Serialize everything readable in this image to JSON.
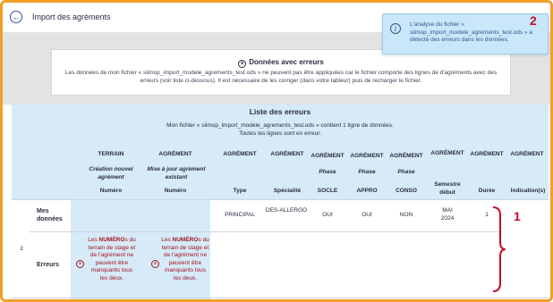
{
  "header": {
    "title": "Import des agréments",
    "back_icon": "back-arrow-icon"
  },
  "toast": {
    "text": "L'analyse du fichier « siimop_import_modele_agrements_test.ods » a détecté des erreurs dans les données.",
    "icon": "info-icon",
    "close": "✕"
  },
  "markers": {
    "m1": "1",
    "m2": "2"
  },
  "error_banner": {
    "title": "Données avec erreurs",
    "icon": "error-circle-icon",
    "text": "Les données de mon fichier « siimop_import_modele_agrements_test.ods » ne peuvent pas être appliquées car le fichier comporte des lignes de d'agréments avec des erreurs (voir liste ci-dessous). Il est nécessaire de les corriger (dans votre tableur) puis de recharger le fichier."
  },
  "error_list": {
    "title": "Liste des erreurs",
    "subtitle_1": "Mon fichier « siimop_import_modele_agrements_test.ods » contient 1 ligne de données.",
    "subtitle_2": "Toutes les lignes sont en erreur."
  },
  "table": {
    "group_headers": {
      "terrain": "TERRAIN",
      "agrement_1": "AGRÉMENT",
      "agrement_2": "AGRÉMENT",
      "agrement_3": "AGRÉMENT",
      "agrement_4": "AGRÉMENT",
      "agrement_5": "AGRÉMENT",
      "agrement_6": "AGRÉMENT",
      "agrement_7": "AGRÉMENT",
      "agrement_8": "AGRÉMENT",
      "agrement_9": "AGRÉMENT"
    },
    "sub_headers": {
      "creation": "Création nouvel agrément",
      "mise_a_jour": "Mise à jour agrément existant",
      "phase_socle": "Phase",
      "phase_appro": "Phase",
      "phase_conso": "Phase"
    },
    "columns": {
      "numero_1": "Numéro",
      "numero_2": "Numéro",
      "type": "Type",
      "specialite": "Spécialité",
      "socle": "SOCLE",
      "appro": "APPRO",
      "conso": "CONSO",
      "semestre": "Semestre début",
      "duree": "Durée",
      "indications": "Indication(s)"
    },
    "row": {
      "index": "2",
      "mes_donnees_label": "Mes données",
      "erreurs_label": "Erreurs",
      "type": "PRINCIPAL",
      "specialite": "DES-ALLERGO",
      "socle": "OUI",
      "appro": "OUI",
      "conso": "NON",
      "semestre": "MAI 2024",
      "duree": "1",
      "err_terrain_pre": "Les ",
      "err_terrain_bold": "NUMÉRO",
      "err_terrain_post": "s du terrain de stage et de l'agrément ne peuvent être manquants tous les deux.",
      "err_agrement_pre": "Les ",
      "err_agrement_bold": "NUMÉRO",
      "err_agrement_post": "s du terrain de stage et de l'agrément ne peuvent être manquants tous les deux."
    }
  },
  "colors": {
    "accent_border": "#f0a028",
    "toast_bg": "#c9e6fa",
    "list_bg": "#d6eaf8",
    "error_text": "#a3121e",
    "marker": "#c0102a"
  }
}
